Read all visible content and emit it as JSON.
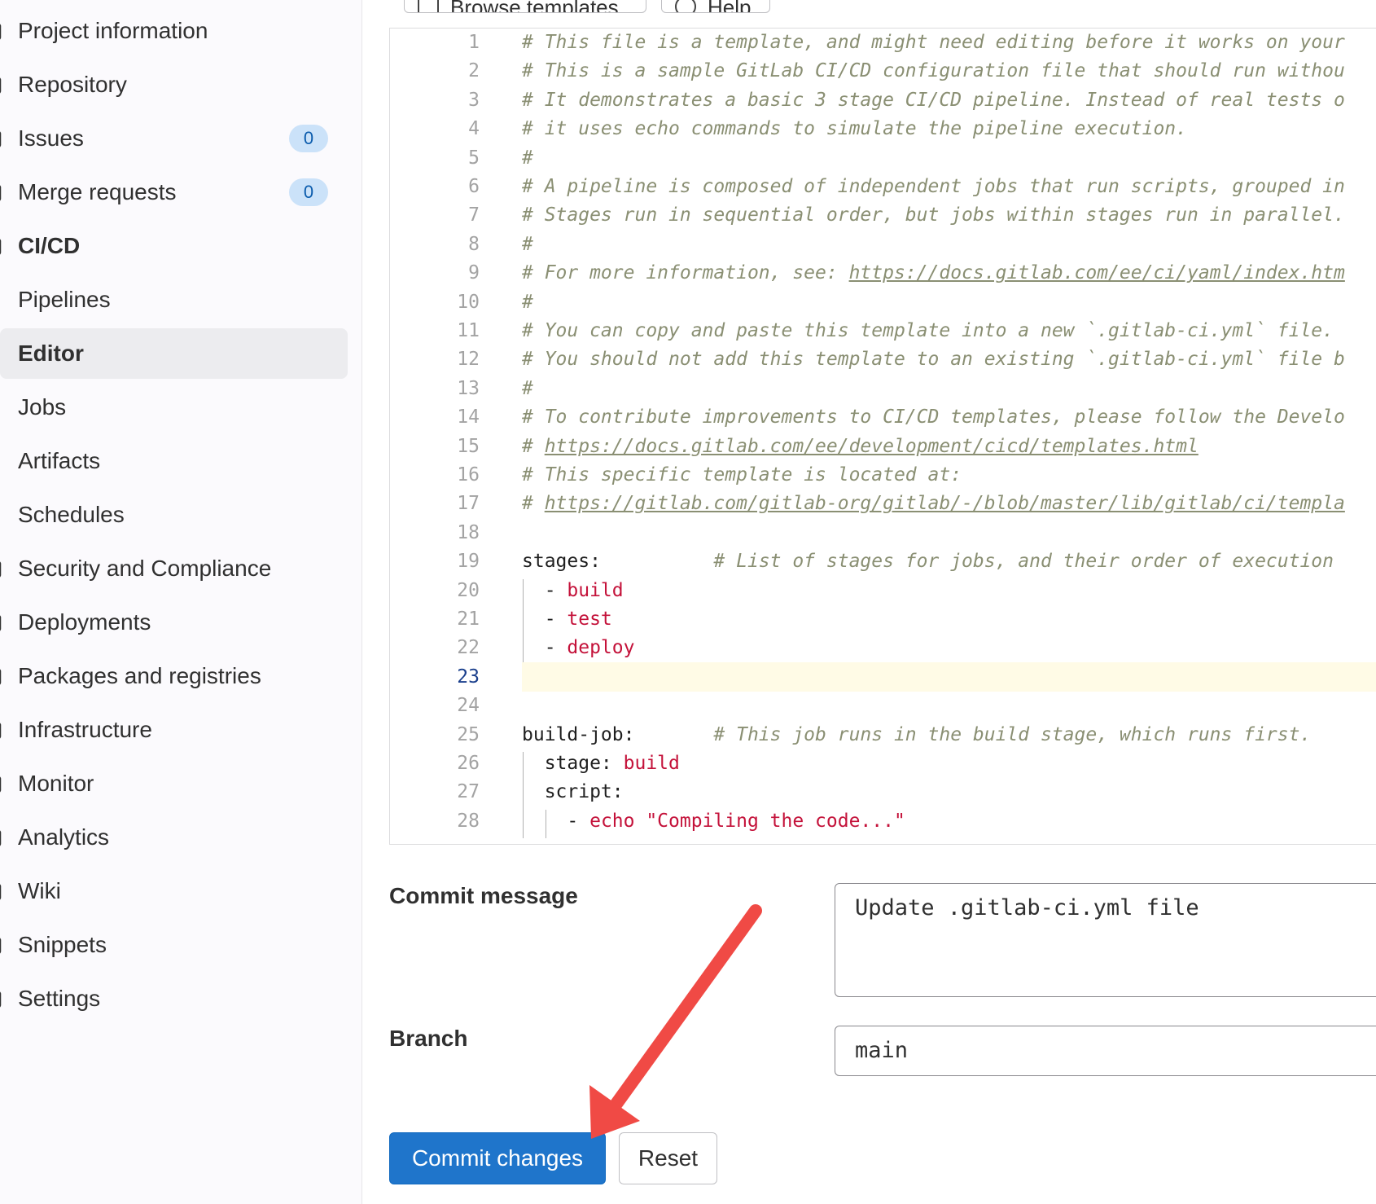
{
  "sidebar": {
    "items": [
      {
        "label": "Project information",
        "kind": "section"
      },
      {
        "label": "Repository",
        "kind": "section"
      },
      {
        "label": "Issues",
        "kind": "section",
        "badge": "0"
      },
      {
        "label": "Merge requests",
        "kind": "section",
        "badge": "0"
      },
      {
        "label": "CI/CD",
        "kind": "section-bold"
      },
      {
        "label": "Pipelines",
        "kind": "sub"
      },
      {
        "label": "Editor",
        "kind": "sub",
        "active": true
      },
      {
        "label": "Jobs",
        "kind": "sub"
      },
      {
        "label": "Artifacts",
        "kind": "sub"
      },
      {
        "label": "Schedules",
        "kind": "sub"
      },
      {
        "label": "Security and Compliance",
        "kind": "section"
      },
      {
        "label": "Deployments",
        "kind": "section"
      },
      {
        "label": "Packages and registries",
        "kind": "section"
      },
      {
        "label": "Infrastructure",
        "kind": "section"
      },
      {
        "label": "Monitor",
        "kind": "section"
      },
      {
        "label": "Analytics",
        "kind": "section"
      },
      {
        "label": "Wiki",
        "kind": "section"
      },
      {
        "label": "Snippets",
        "kind": "section"
      },
      {
        "label": "Settings",
        "kind": "section"
      }
    ]
  },
  "toolbar": {
    "browse_templates": "Browse templates",
    "help": "Help"
  },
  "editor": {
    "current_line": 23,
    "lines": [
      {
        "n": "1",
        "parts": [
          [
            "c",
            "# This file is a template, and might need editing before it works on your"
          ]
        ]
      },
      {
        "n": "2",
        "parts": [
          [
            "c",
            "# This is a sample GitLab CI/CD configuration file that should run withou"
          ]
        ]
      },
      {
        "n": "3",
        "parts": [
          [
            "c",
            "# It demonstrates a basic 3 stage CI/CD pipeline. Instead of real tests o"
          ]
        ]
      },
      {
        "n": "4",
        "parts": [
          [
            "c",
            "# it uses echo commands to simulate the pipeline execution."
          ]
        ]
      },
      {
        "n": "5",
        "parts": [
          [
            "c",
            "#"
          ]
        ]
      },
      {
        "n": "6",
        "parts": [
          [
            "c",
            "# A pipeline is composed of independent jobs that run scripts, grouped in"
          ]
        ]
      },
      {
        "n": "7",
        "parts": [
          [
            "c",
            "# Stages run in sequential order, but jobs within stages run in parallel."
          ]
        ]
      },
      {
        "n": "8",
        "parts": [
          [
            "c",
            "#"
          ]
        ]
      },
      {
        "n": "9",
        "parts": [
          [
            "c",
            "# For more information, see: "
          ],
          [
            "l",
            "https://docs.gitlab.com/ee/ci/yaml/index.htm"
          ]
        ]
      },
      {
        "n": "10",
        "parts": [
          [
            "c",
            "#"
          ]
        ]
      },
      {
        "n": "11",
        "parts": [
          [
            "c",
            "# You can copy and paste this template into a new `.gitlab-ci.yml` file."
          ]
        ]
      },
      {
        "n": "12",
        "parts": [
          [
            "c",
            "# You should not add this template to an existing `.gitlab-ci.yml` file b"
          ]
        ]
      },
      {
        "n": "13",
        "parts": [
          [
            "c",
            "#"
          ]
        ]
      },
      {
        "n": "14",
        "parts": [
          [
            "c",
            "# To contribute improvements to CI/CD templates, please follow the Develo"
          ]
        ]
      },
      {
        "n": "15",
        "parts": [
          [
            "c",
            "# "
          ],
          [
            "l",
            "https://docs.gitlab.com/ee/development/cicd/templates.html"
          ]
        ]
      },
      {
        "n": "16",
        "parts": [
          [
            "c",
            "# This specific template is located at:"
          ]
        ]
      },
      {
        "n": "17",
        "parts": [
          [
            "c",
            "# "
          ],
          [
            "l",
            "https://gitlab.com/gitlab-org/gitlab/-/blob/master/lib/gitlab/ci/templa"
          ]
        ]
      },
      {
        "n": "18",
        "parts": []
      },
      {
        "n": "19",
        "parts": [
          [
            "k",
            "stages:          "
          ],
          [
            "c",
            "# List of stages for jobs, and their order of execution"
          ]
        ]
      },
      {
        "n": "20",
        "parts": [
          [
            "k",
            "  - "
          ],
          [
            "v",
            "build"
          ]
        ]
      },
      {
        "n": "21",
        "parts": [
          [
            "k",
            "  - "
          ],
          [
            "v",
            "test"
          ]
        ]
      },
      {
        "n": "22",
        "parts": [
          [
            "k",
            "  - "
          ],
          [
            "v",
            "deploy"
          ]
        ]
      },
      {
        "n": "23",
        "parts": []
      },
      {
        "n": "24",
        "parts": []
      },
      {
        "n": "25",
        "parts": [
          [
            "k",
            "build-job:       "
          ],
          [
            "c",
            "# This job runs in the build stage, which runs first."
          ]
        ]
      },
      {
        "n": "26",
        "parts": [
          [
            "k",
            "  stage: "
          ],
          [
            "v",
            "build"
          ]
        ]
      },
      {
        "n": "27",
        "parts": [
          [
            "k",
            "  script:"
          ]
        ]
      },
      {
        "n": "28",
        "parts": [
          [
            "k",
            "    - "
          ],
          [
            "v",
            "echo \"Compiling the code...\""
          ]
        ]
      }
    ]
  },
  "form": {
    "commit_message_label": "Commit message",
    "commit_message_value": "Update .gitlab-ci.yml file",
    "branch_label": "Branch",
    "branch_value": "main",
    "commit_button": "Commit changes",
    "reset_button": "Reset"
  },
  "colors": {
    "primary": "#1f75cb",
    "annotation_arrow": "#f04a45",
    "badge_bg": "#cbe2f9"
  }
}
